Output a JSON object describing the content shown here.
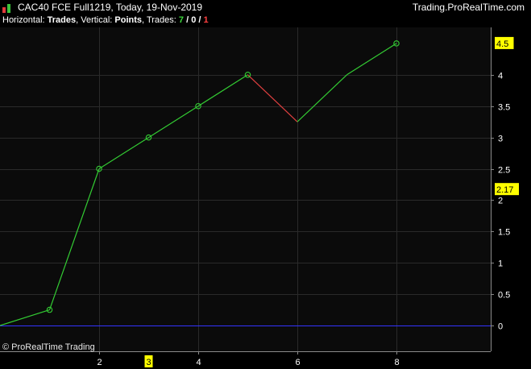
{
  "window": {
    "title": "CAC40 FCE Full1219, Today, 19-Nov-2019",
    "brand": "Trading.ProRealTime.com"
  },
  "info": {
    "horizontal_label": "Horizontal: ",
    "horizontal_value": "Trades",
    "vertical_label": ", Vertical: ",
    "vertical_value": "Points",
    "trades_label": ", Trades: ",
    "trades_won": "7",
    "sep1": " / ",
    "trades_neutral": "0",
    "sep2": " / ",
    "trades_lost": "1"
  },
  "footer": {
    "copyright": "© ProRealTime Trading"
  },
  "colors": {
    "background": "#000000",
    "plot_background": "#0b0b0b",
    "up_line": "#33cc33",
    "down_line": "#e04040",
    "zero_line": "#3333ff",
    "highlight_label": "#ffff00",
    "grid": "#2a2a2a"
  },
  "chart_data": {
    "type": "line",
    "x": [
      0,
      1,
      2,
      3,
      4,
      5,
      6,
      7,
      8
    ],
    "values": [
      0,
      0.25,
      2.5,
      3,
      3.5,
      4,
      3.25,
      4,
      4.5
    ],
    "markers_at_x": [
      1,
      2,
      3,
      4,
      5,
      8
    ],
    "segment_colors": [
      "up",
      "up",
      "up",
      "up",
      "up",
      "down",
      "up",
      "up"
    ],
    "xlim": [
      0,
      10
    ],
    "ylim": [
      -0.45,
      4.7
    ],
    "x_ticks": [
      2,
      4,
      6,
      8
    ],
    "x_tick_labels": [
      "2",
      "4",
      "6",
      "8"
    ],
    "highlighted_x": {
      "value": 3,
      "label": "3"
    },
    "y_ticks": [
      0,
      0.5,
      1,
      1.5,
      2,
      2.5,
      3,
      3.5,
      4
    ],
    "y_tick_labels": [
      "0",
      "0.5",
      "1",
      "1.5",
      "2",
      "2.5",
      "3",
      "3.5",
      "4"
    ],
    "highlighted_y": [
      {
        "value": 4.5,
        "label": "4.5"
      },
      {
        "value": 2.17,
        "label": "2.17"
      }
    ],
    "zero_line": 0,
    "grid": true,
    "title": "",
    "xlabel": "",
    "ylabel": ""
  }
}
